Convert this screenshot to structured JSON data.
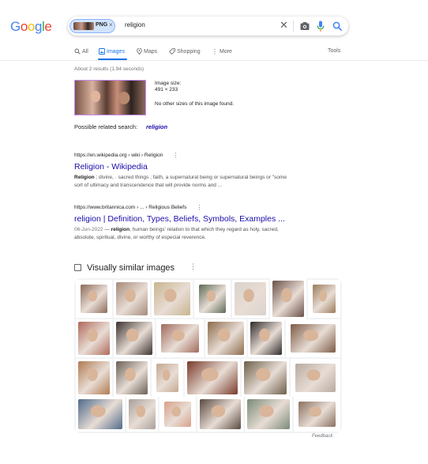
{
  "header": {
    "logo": [
      "G",
      "o",
      "o",
      "g",
      "l",
      "e"
    ],
    "logo_colors": [
      "#4285f4",
      "#ea4335",
      "#fbbc05",
      "#4285f4",
      "#34a853",
      "#ea4335"
    ],
    "chip_label": "PNG",
    "chip_close": "×",
    "query": "religion",
    "clear_symbol": "✕"
  },
  "tabs": {
    "all": "All",
    "images": "Images",
    "maps": "Maps",
    "shopping": "Shopping",
    "more": "More",
    "tools": "Tools"
  },
  "result_stats": "About 2 results (1.94 seconds)",
  "image_info": {
    "size_label": "Image size:",
    "size_value": "491 × 233",
    "other_sizes": "No other sizes of this image found."
  },
  "related": {
    "label": "Possible related search:",
    "query": "religion"
  },
  "results": [
    {
      "cite": "https://en.wikipedia.org › wiki › Religion",
      "title": "Religion - Wikipedia",
      "snippet_bold": "Religion",
      "snippet_line1": " ; divine, · sacred things ; faith, a supernatural being or supernatural beings or \"some",
      "snippet_line2": "sort of ultimacy and transcendence that will provide norms and ..."
    },
    {
      "cite": "https://www.britannica.com › ... › Religious Beliefs",
      "title": "religion | Definition, Types, Beliefs, Symbols, Examples ...",
      "date": "06-Jun-2022",
      "snippet_dash": " — ",
      "snippet_bold": "religion",
      "snippet_line1": ", human beings' relation to that which they regard as holy, sacred,",
      "snippet_line2": "absolute, spiritual, divine, or worthy of especial reverence."
    }
  ],
  "similar": {
    "heading": "Visually similar images",
    "more_symbol": "⋮",
    "feedback": "Feedback",
    "tile_colors": [
      "#8b6b5a",
      "#a58a7a",
      "#c8b48f",
      "#5c6b55",
      "#d9d2cc",
      "#6a5048",
      "#9b7a5a",
      "#b0685a",
      "#3b3230",
      "#a16a5c",
      "#8c6a4a",
      "#2f2a2a",
      "#7d5a45",
      "#b07a50",
      "#6b6055",
      "#c4a890",
      "#7a3a2a",
      "#6d5f4a",
      "#b8aaa0",
      "#4f6a8a",
      "#a8a09a",
      "#d8a088",
      "#5a4a40",
      "#7a8a78",
      "#8a7060",
      "#9a8a7a"
    ]
  }
}
